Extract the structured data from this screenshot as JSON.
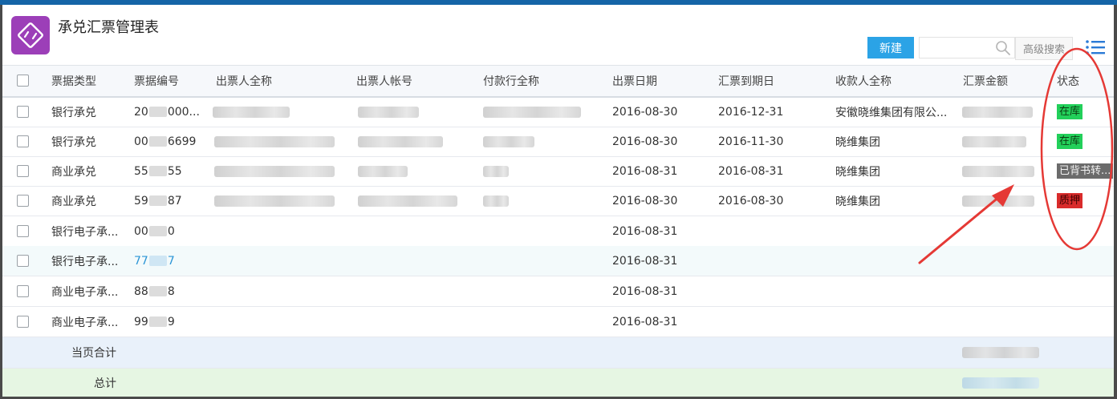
{
  "app": {
    "title": "承兑汇票管理表",
    "icon": "exchange-icon",
    "accent": "#9c3fb8"
  },
  "toolbar": {
    "new_label": "新建",
    "search_value": "",
    "search_placeholder": "",
    "advanced_label": "高级搜索"
  },
  "table": {
    "headers": {
      "type": "票据类型",
      "number": "票据编号",
      "drawer_name": "出票人全称",
      "drawer_account": "出票人帐号",
      "bank_name": "付款行全称",
      "issue_date": "出票日期",
      "due_date": "汇票到期日",
      "payee_name": "收款人全称",
      "amount": "汇票金额",
      "status": "状态"
    },
    "rows": [
      {
        "type": "银行承兑",
        "num_prefix": "20",
        "num_suffix": "000...",
        "issue_date": "2016-08-30",
        "due_date": "2016-12-31",
        "payee": "安徽晓维集团有限公...",
        "status": "在库"
      },
      {
        "type": "银行承兑",
        "num_prefix": "00",
        "num_suffix": "6699",
        "issue_date": "2016-08-30",
        "due_date": "2016-11-30",
        "payee": "晓维集团",
        "status": "在库"
      },
      {
        "type": "商业承兑",
        "num_prefix": "55",
        "num_suffix": "55",
        "issue_date": "2016-08-31",
        "due_date": "2016-08-31",
        "payee": "晓维集团",
        "status": "已背书转..."
      },
      {
        "type": "商业承兑",
        "num_prefix": "59",
        "num_suffix": "87",
        "issue_date": "2016-08-30",
        "due_date": "2016-08-30",
        "payee": "晓维集团",
        "status": "质押"
      },
      {
        "type": "银行电子承...",
        "num_prefix": "00",
        "num_suffix": "0",
        "issue_date": "2016-08-31",
        "due_date": "",
        "payee": "",
        "status": ""
      },
      {
        "type": "银行电子承...",
        "num_prefix": "77",
        "num_suffix": "7",
        "issue_date": "2016-08-31",
        "due_date": "",
        "payee": "",
        "status": ""
      },
      {
        "type": "商业电子承...",
        "num_prefix": "88",
        "num_suffix": "8",
        "issue_date": "2016-08-31",
        "due_date": "",
        "payee": "",
        "status": ""
      },
      {
        "type": "商业电子承...",
        "num_prefix": "99",
        "num_suffix": "9",
        "issue_date": "2016-08-31",
        "due_date": "",
        "payee": "",
        "status": ""
      }
    ],
    "page_total_label": "当页合计",
    "grand_total_label": "总计"
  },
  "colors": {
    "status_in_stock": "#22d05a",
    "status_endorsed": "#6b6b6b",
    "status_pledged": "#d92b2b",
    "link": "#2b95d6",
    "annotation": "#e53935"
  }
}
